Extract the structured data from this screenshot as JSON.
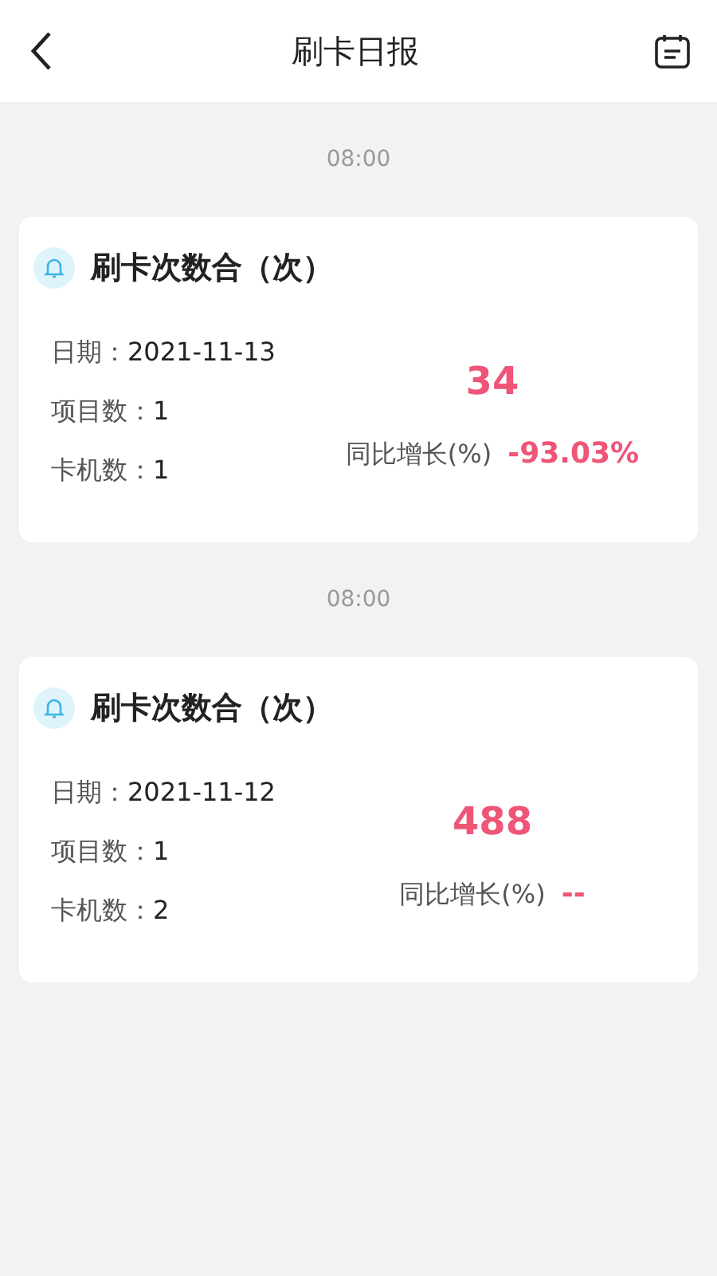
{
  "header": {
    "title": "刷卡日报"
  },
  "reports": [
    {
      "time": "08:00",
      "title": "刷卡次数合（次）",
      "fields": [
        {
          "label": "日期：",
          "value": "2021-11-13"
        },
        {
          "label": "项目数：",
          "value": "1"
        },
        {
          "label": "卡机数：",
          "value": "1"
        }
      ],
      "count": "34",
      "growth_label": "同比增长(%)",
      "growth_value": "-93.03%"
    },
    {
      "time": "08:00",
      "title": "刷卡次数合（次）",
      "fields": [
        {
          "label": "日期：",
          "value": "2021-11-12"
        },
        {
          "label": "项目数：",
          "value": "1"
        },
        {
          "label": "卡机数：",
          "value": "2"
        }
      ],
      "count": "488",
      "growth_label": "同比增长(%)",
      "growth_value": "--"
    }
  ]
}
